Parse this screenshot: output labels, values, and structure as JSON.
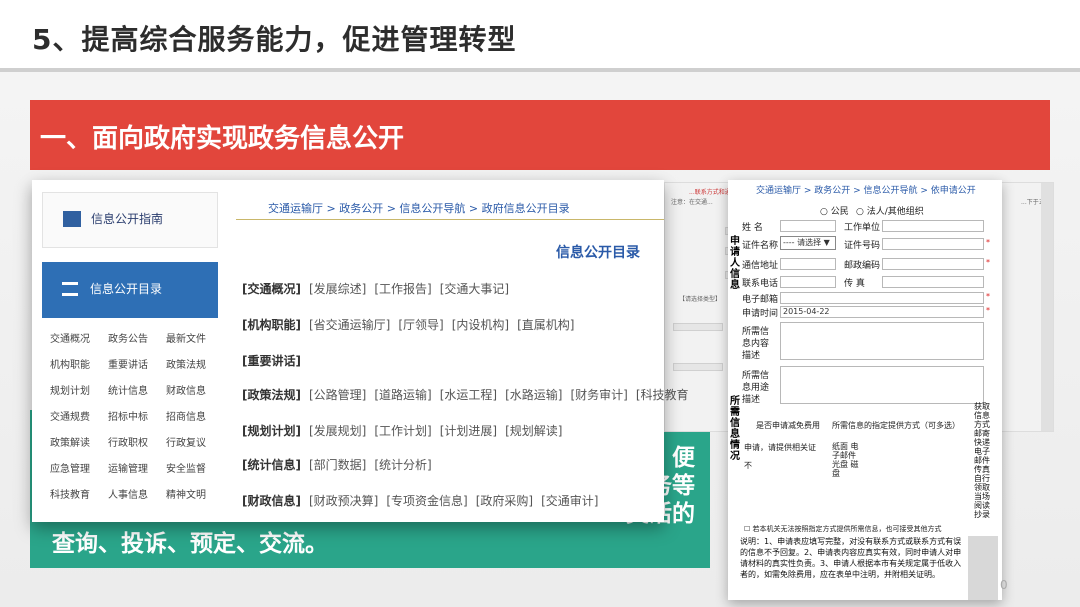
{
  "slide": {
    "title": "5、提高综合服务能力，促进管理转型",
    "banner": "一、面向政府实现政务信息公开",
    "teal_lines": [
      "务、便",
      "服务等",
      "灵活的",
      "查询、投诉、预定、交流。"
    ],
    "page_number": "0"
  },
  "portal": {
    "guide_label": "信息公开指南",
    "catalog_label": "信息公开目录",
    "grid": [
      [
        "交通概况",
        "政务公告",
        "最新文件"
      ],
      [
        "机构职能",
        "重要讲话",
        "政策法规"
      ],
      [
        "规划计划",
        "统计信息",
        "财政信息"
      ],
      [
        "交通规费",
        "招标中标",
        "招商信息"
      ],
      [
        "政策解读",
        "行政职权",
        "行政复议"
      ],
      [
        "应急管理",
        "运输管理",
        "安全监督"
      ],
      [
        "科技教育",
        "人事信息",
        "精神文明"
      ]
    ],
    "breadcrumb": "交通运输厅 > 政务公开 > 信息公开导航 > 政府信息公开目录",
    "directory_title": "信息公开目录",
    "rows": [
      {
        "head": "[交通概况]",
        "links": [
          "[发展综述]",
          "[工作报告]",
          "[交通大事记]"
        ]
      },
      {
        "head": "[机构职能]",
        "links": [
          "[省交通运输厅]",
          "[厅领导]",
          "[内设机构]",
          "[直属机构]"
        ]
      },
      {
        "head": "[重要讲话]",
        "links": []
      },
      {
        "head": "[政策法规]",
        "links": [
          "[公路管理]",
          "[道路运输]",
          "[水运工程]",
          "[水路运输]",
          "[财务审计]",
          "[科技教育"
        ]
      },
      {
        "head": "[规划计划]",
        "links": [
          "[发展规划]",
          "[工作计划]",
          "[计划进展]",
          "[规划解读]"
        ]
      },
      {
        "head": "[统计信息]",
        "links": [
          "[部门数据]",
          "[统计分析]"
        ]
      },
      {
        "head": "[财政信息]",
        "links": [
          "[财政预决算]",
          "[专项资金信息]",
          "[政府采购]",
          "[交通审计]"
        ]
      }
    ]
  },
  "back_form": {
    "top_text": "...联系方式和通信地址",
    "hint_left": "注意：在交通...",
    "hint_right": "...下于五日",
    "select_text": "【请选择类型】"
  },
  "form": {
    "breadcrumb": "交通运输厅 > 政务公开 > 信息公开导航 > 依申请公开",
    "radio_public": "○ 公民",
    "radio_org": "○ 法人/其他组织",
    "side_applicant": "申请人信息",
    "side_required": "所需信息情况",
    "name_label": "姓 名",
    "work_unit_label": "工作单位",
    "id_type_label": "证件名称",
    "id_type_value": "---- 请选择 ▼",
    "id_number_label": "证件号码",
    "address_label": "通信地址",
    "postcode_label": "邮政编码",
    "phone_label": "联系电话",
    "fax_label": "传 真",
    "email_label": "电子邮箱",
    "date_label": "申请时间",
    "date_value": "2015-04-22",
    "content_label": "所需信息内容描述",
    "purpose_label": "所需信息用途描述",
    "fee_label": "是否申请减免费用",
    "method_label": "所需信息的指定提供方式（可多选）",
    "fee_apply": "申请，请提供相关证",
    "fee_no": "不",
    "methods": "纸面 电子邮件 光盘 磁盘",
    "alt_method": "☐ 若本机关无法按照指定方式提供所需信息，也可接受其他方式",
    "notes": "说明：1、申请表应填写完整，对没有联系方式或联系方式有误的信息不予回复。2、申请表内容应真实有效，同时申请人对申请材料的真实性负责。3、申请人根据本市有关规定属于低收入者的，如需免除费用，应在表单中注明，并附相关证明。",
    "right_col": "获取信息方式 邮寄 快递 电子邮件 传真 自行领取 当场阅读 抄录"
  },
  "colors": {
    "banner": "#e2463c",
    "teal": "#2aa58a",
    "portal_blue": "#2e6fb5",
    "link_blue": "#2a5aa8"
  }
}
